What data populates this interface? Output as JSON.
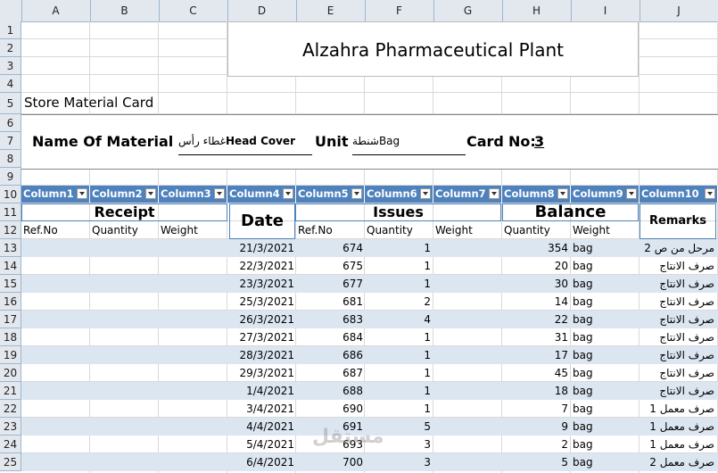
{
  "title": "Alzahra Pharmaceutical Plant",
  "store_card": "Store Material Card",
  "material": {
    "name_label": "Name Of Material",
    "name_ar": "غطاء رأس",
    "name_en": "Head Cover",
    "unit_label": "Unit",
    "unit_ar": "شنطة",
    "unit_en": "Bag",
    "card_label": "Card",
    "card_no_label": "No:",
    "card_no": "3"
  },
  "col_letters": [
    "A",
    "B",
    "C",
    "D",
    "E",
    "F",
    "G",
    "H",
    "I",
    "J"
  ],
  "row_numbers": [
    "1",
    "2",
    "3",
    "4",
    "5",
    "6",
    "7",
    "8",
    "9",
    "10",
    "11",
    "12",
    "13",
    "14",
    "15",
    "16",
    "17",
    "18",
    "19",
    "20",
    "21",
    "22",
    "23",
    "24",
    "25"
  ],
  "table_headers": [
    "Column1",
    "Column2",
    "Column3",
    "Column4",
    "Column5",
    "Column6",
    "Column7",
    "Column8",
    "Column9",
    "Column10"
  ],
  "group_headers": {
    "receipt": "Receipt",
    "date": "Date",
    "issues": "Issues",
    "balance": "Balance",
    "remarks": "Remarks"
  },
  "sub_headers": {
    "ref_no": "Ref.No",
    "quantity": "Quantity",
    "weight": "Weight",
    "issues_ref": "Ref.No",
    "issues_qty": "Quantity",
    "issues_weight": "Weight",
    "bal_qty": "Quantity",
    "bal_weight": "Weight"
  },
  "rows": [
    {
      "date": "21/3/2021",
      "ref": "674",
      "qty": "1",
      "bal": "354",
      "weight": "bag",
      "remark": "مرحل من ص 2"
    },
    {
      "date": "22/3/2021",
      "ref": "675",
      "qty": "1",
      "bal": "20",
      "weight": "bag",
      "remark": "صرف الانتاج"
    },
    {
      "date": "23/3/2021",
      "ref": "677",
      "qty": "1",
      "bal": "30",
      "weight": "bag",
      "remark": "صرف الانتاج"
    },
    {
      "date": "25/3/2021",
      "ref": "681",
      "qty": "2",
      "bal": "14",
      "weight": "bag",
      "remark": "صرف الانتاج"
    },
    {
      "date": "26/3/2021",
      "ref": "683",
      "qty": "4",
      "bal": "22",
      "weight": "bag",
      "remark": "صرف الانتاج"
    },
    {
      "date": "27/3/2021",
      "ref": "684",
      "qty": "1",
      "bal": "31",
      "weight": "bag",
      "remark": "صرف الانتاج"
    },
    {
      "date": "28/3/2021",
      "ref": "686",
      "qty": "1",
      "bal": "17",
      "weight": "bag",
      "remark": "صرف الانتاج"
    },
    {
      "date": "29/3/2021",
      "ref": "687",
      "qty": "1",
      "bal": "45",
      "weight": "bag",
      "remark": "صرف الانتاج"
    },
    {
      "date": "1/4/2021",
      "ref": "688",
      "qty": "1",
      "bal": "18",
      "weight": "bag",
      "remark": "صرف الانتاج"
    },
    {
      "date": "3/4/2021",
      "ref": "690",
      "qty": "1",
      "bal": "7",
      "weight": "bag",
      "remark": "صرف معمل 1"
    },
    {
      "date": "4/4/2021",
      "ref": "691",
      "qty": "5",
      "bal": "9",
      "weight": "bag",
      "remark": "صرف معمل 1"
    },
    {
      "date": "5/4/2021",
      "ref": "693",
      "qty": "3",
      "bal": "2",
      "weight": "bag",
      "remark": "صرف معمل 1"
    },
    {
      "date": "6/4/2021",
      "ref": "700",
      "qty": "3",
      "bal": "5",
      "weight": "bag",
      "remark": "صرف معمل 2"
    }
  ],
  "watermark": "مستقل",
  "colors": {
    "header_bg": "#4f81bd",
    "band": "#dce6f1"
  }
}
